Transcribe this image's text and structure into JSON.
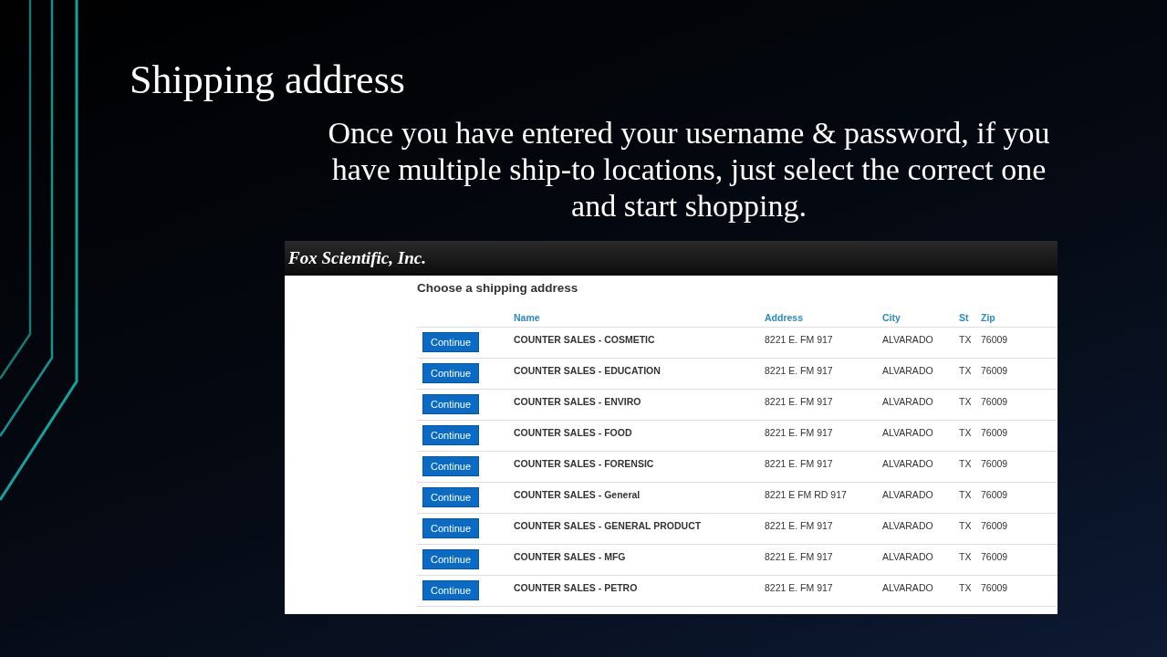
{
  "slide": {
    "title": "Shipping address",
    "body": "Once you have entered your username & password, if you have multiple ship-to locations, just select the correct one and start shopping."
  },
  "screenshot": {
    "brand": "Fox Scientific, Inc.",
    "heading": "Choose a shipping address",
    "table": {
      "columns": [
        "Name",
        "Address",
        "City",
        "St",
        "Zip"
      ],
      "rows": [
        {
          "button": "Continue",
          "name": "COUNTER SALES - COSMETIC",
          "address": "8221 E. FM 917",
          "city": "ALVARADO",
          "st": "TX",
          "zip": "76009"
        },
        {
          "button": "Continue",
          "name": "COUNTER SALES - EDUCATION",
          "address": "8221 E. FM 917",
          "city": "ALVARADO",
          "st": "TX",
          "zip": "76009"
        },
        {
          "button": "Continue",
          "name": "COUNTER SALES - ENVIRO",
          "address": "8221 E. FM 917",
          "city": "ALVARADO",
          "st": "TX",
          "zip": "76009"
        },
        {
          "button": "Continue",
          "name": "COUNTER SALES - FOOD",
          "address": "8221 E. FM 917",
          "city": "ALVARADO",
          "st": "TX",
          "zip": "76009"
        },
        {
          "button": "Continue",
          "name": "COUNTER SALES - FORENSIC",
          "address": "8221 E. FM 917",
          "city": "ALVARADO",
          "st": "TX",
          "zip": "76009"
        },
        {
          "button": "Continue",
          "name": "COUNTER SALES - General",
          "address": "8221 E FM RD 917",
          "city": "ALVARADO",
          "st": "TX",
          "zip": "76009"
        },
        {
          "button": "Continue",
          "name": "COUNTER SALES - GENERAL PRODUCT",
          "address": "8221 E. FM 917",
          "city": "ALVARADO",
          "st": "TX",
          "zip": "76009"
        },
        {
          "button": "Continue",
          "name": "COUNTER SALES - MFG",
          "address": "8221 E. FM 917",
          "city": "ALVARADO",
          "st": "TX",
          "zip": "76009"
        },
        {
          "button": "Continue",
          "name": "COUNTER SALES - PETRO",
          "address": "8221 E. FM 917",
          "city": "ALVARADO",
          "st": "TX",
          "zip": "76009"
        }
      ]
    }
  }
}
